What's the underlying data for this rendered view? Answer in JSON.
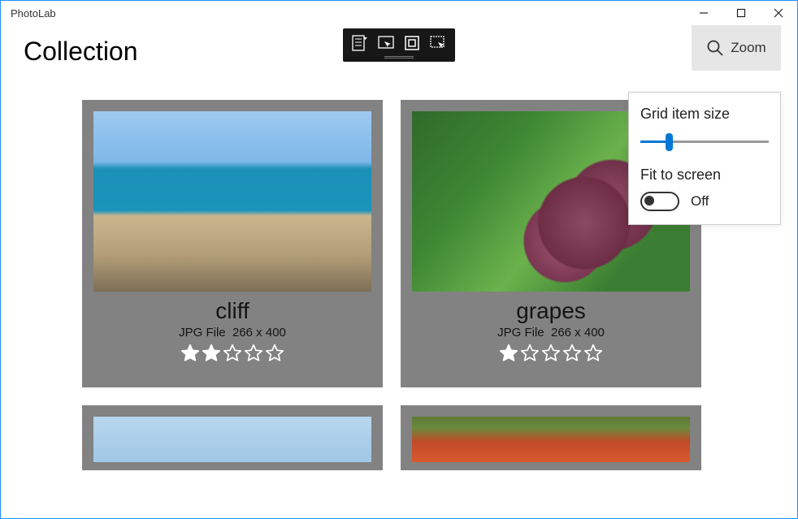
{
  "window": {
    "title": "PhotoLab"
  },
  "header": {
    "page_title": "Collection",
    "zoom_label": "Zoom"
  },
  "zoom_panel": {
    "size_label": "Grid item size",
    "fit_label": "Fit to screen",
    "toggle_state": "Off"
  },
  "cards": [
    {
      "title": "cliff",
      "filetype": "JPG File",
      "dimensions": "266 x 400",
      "rating": 2,
      "rating_max": 5
    },
    {
      "title": "grapes",
      "filetype": "JPG File",
      "dimensions": "266 x 400",
      "rating": 1,
      "rating_max": 5
    }
  ]
}
